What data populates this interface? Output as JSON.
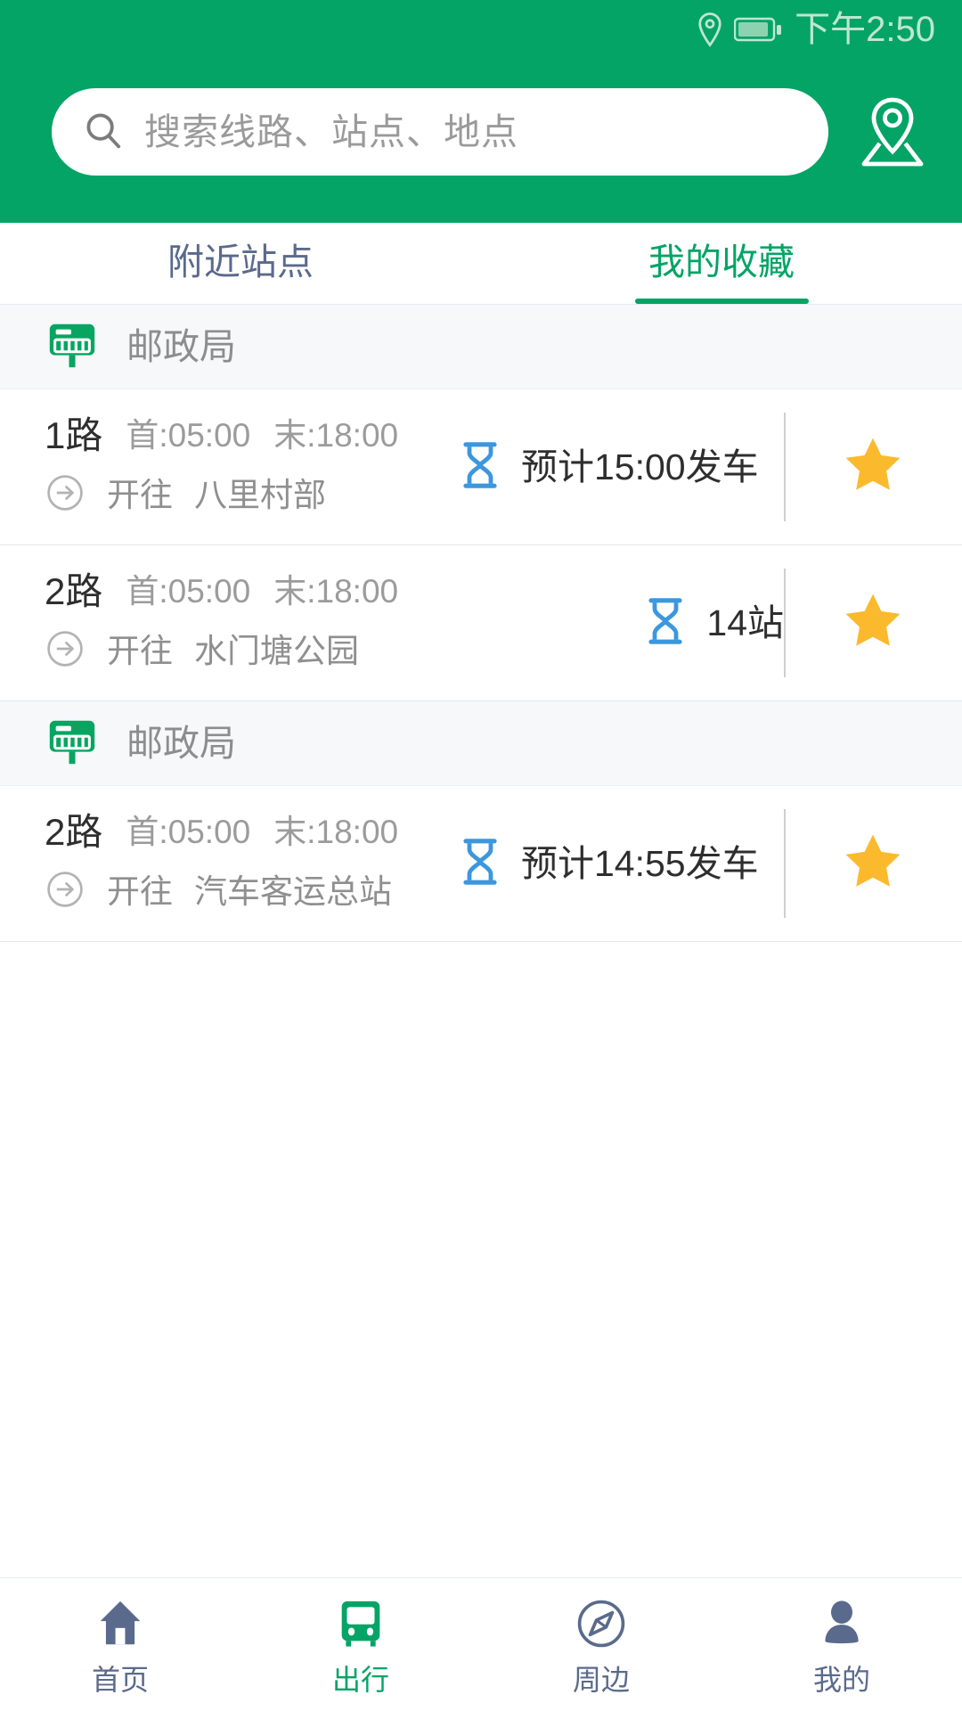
{
  "theme": {
    "brand_green": "#04A466",
    "star_gold": "#FBBA2D",
    "hourglass_blue": "#3B97DE",
    "slate": "#5A6A8C",
    "muted_gray": "#9B9B9B"
  },
  "statusbar": {
    "location_icon": "location-pin-icon",
    "battery_icon": "battery-icon",
    "time": "下午2:50"
  },
  "search": {
    "icon": "search-icon",
    "placeholder": "搜索线路、站点、地点",
    "value": "",
    "map_pin_icon": "map-location-icon"
  },
  "tabs": [
    {
      "label": "附近站点",
      "active": false
    },
    {
      "label": "我的收藏",
      "active": true
    }
  ],
  "groups": [
    {
      "station_icon": "bus-stop-sign-icon",
      "station": "邮政局",
      "routes": [
        {
          "number": "1路",
          "first_label": "首:05:00",
          "last_label": "末:18:00",
          "direction_icon": "arrow-right-circle-icon",
          "direction_prefix": "开往",
          "destination": "八里村部",
          "eta_icon": "hourglass-icon",
          "eta_text": "预计15:00发车",
          "eta_compact": false,
          "favorite_icon": "star-filled-icon",
          "favorite": true
        },
        {
          "number": "2路",
          "first_label": "首:05:00",
          "last_label": "末:18:00",
          "direction_icon": "arrow-right-circle-icon",
          "direction_prefix": "开往",
          "destination": "水门塘公园",
          "eta_icon": "hourglass-icon",
          "eta_text": "14站",
          "eta_compact": true,
          "favorite_icon": "star-filled-icon",
          "favorite": true
        }
      ]
    },
    {
      "station_icon": "bus-stop-sign-icon",
      "station": "邮政局",
      "routes": [
        {
          "number": "2路",
          "first_label": "首:05:00",
          "last_label": "末:18:00",
          "direction_icon": "arrow-right-circle-icon",
          "direction_prefix": "开往",
          "destination": "汽车客运总站",
          "eta_icon": "hourglass-icon",
          "eta_text": "预计14:55发车",
          "eta_compact": false,
          "favorite_icon": "star-filled-icon",
          "favorite": true
        }
      ]
    }
  ],
  "bottom_nav": [
    {
      "label": "首页",
      "icon": "home-icon",
      "active": false
    },
    {
      "label": "出行",
      "icon": "bus-icon",
      "active": true
    },
    {
      "label": "周边",
      "icon": "compass-icon",
      "active": false
    },
    {
      "label": "我的",
      "icon": "person-icon",
      "active": false
    }
  ]
}
